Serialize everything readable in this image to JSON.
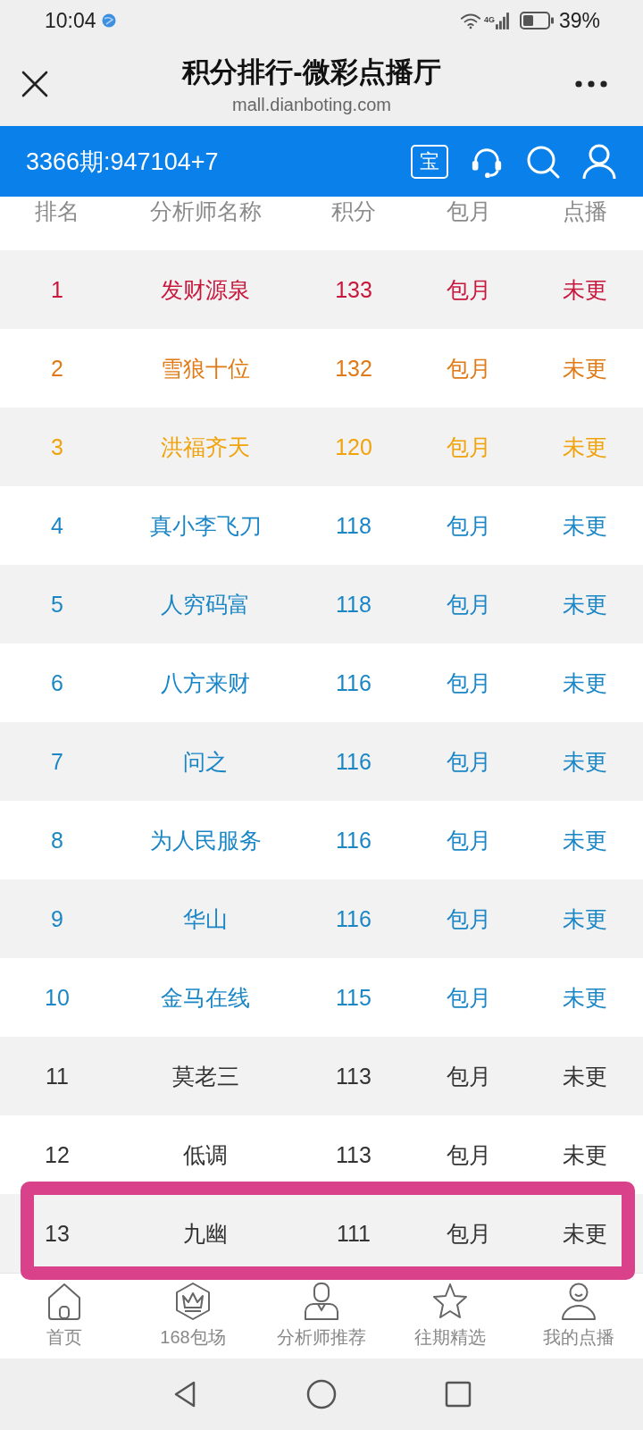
{
  "status_bar": {
    "time": "10:04",
    "network": "4G",
    "battery": "39%"
  },
  "browser_header": {
    "title": "积分排行-微彩点播厅",
    "url": "mall.dianboting.com"
  },
  "toolbar": {
    "draw_info": "3366期:947104+7",
    "badge": "宝"
  },
  "table": {
    "columns": [
      "排名",
      "分析师名称",
      "积分",
      "包月",
      "点播"
    ],
    "rows": [
      {
        "rank": "1",
        "name": "发财源泉",
        "score": "133",
        "monthly": "包月",
        "on_demand": "未更",
        "color": "#c8173d",
        "highlighted": false
      },
      {
        "rank": "2",
        "name": "雪狼十位",
        "score": "132",
        "monthly": "包月",
        "on_demand": "未更",
        "color": "#e07a16",
        "highlighted": false
      },
      {
        "rank": "3",
        "name": "洪福齐天",
        "score": "120",
        "monthly": "包月",
        "on_demand": "未更",
        "color": "#f0a30c",
        "highlighted": false
      },
      {
        "rank": "4",
        "name": "真小李飞刀",
        "score": "118",
        "monthly": "包月",
        "on_demand": "未更",
        "color": "#1a86c6",
        "highlighted": false
      },
      {
        "rank": "5",
        "name": "人穷码富",
        "score": "118",
        "monthly": "包月",
        "on_demand": "未更",
        "color": "#1a86c6",
        "highlighted": false
      },
      {
        "rank": "6",
        "name": "八方来财",
        "score": "116",
        "monthly": "包月",
        "on_demand": "未更",
        "color": "#1a86c6",
        "highlighted": false
      },
      {
        "rank": "7",
        "name": "问之",
        "score": "116",
        "monthly": "包月",
        "on_demand": "未更",
        "color": "#1a86c6",
        "highlighted": false
      },
      {
        "rank": "8",
        "name": "为人民服务",
        "score": "116",
        "monthly": "包月",
        "on_demand": "未更",
        "color": "#1a86c6",
        "highlighted": false
      },
      {
        "rank": "9",
        "name": "华山",
        "score": "116",
        "monthly": "包月",
        "on_demand": "未更",
        "color": "#1a86c6",
        "highlighted": false
      },
      {
        "rank": "10",
        "name": "金马在线",
        "score": "115",
        "monthly": "包月",
        "on_demand": "未更",
        "color": "#1a86c6",
        "highlighted": false
      },
      {
        "rank": "11",
        "name": "莫老三",
        "score": "113",
        "monthly": "包月",
        "on_demand": "未更",
        "color": "#333333",
        "highlighted": false
      },
      {
        "rank": "12",
        "name": "低调",
        "score": "113",
        "monthly": "包月",
        "on_demand": "未更",
        "color": "#333333",
        "highlighted": false
      },
      {
        "rank": "13",
        "name": "九幽",
        "score": "111",
        "monthly": "包月",
        "on_demand": "未更",
        "color": "#333333",
        "highlighted": true
      }
    ]
  },
  "bottom_nav": {
    "items": [
      {
        "label": "首页",
        "kind": "home"
      },
      {
        "label": "168包场",
        "kind": "crown"
      },
      {
        "label": "分析师推荐",
        "kind": "analyst"
      },
      {
        "label": "往期精选",
        "kind": "star"
      },
      {
        "label": "我的点播",
        "kind": "profile"
      }
    ]
  }
}
